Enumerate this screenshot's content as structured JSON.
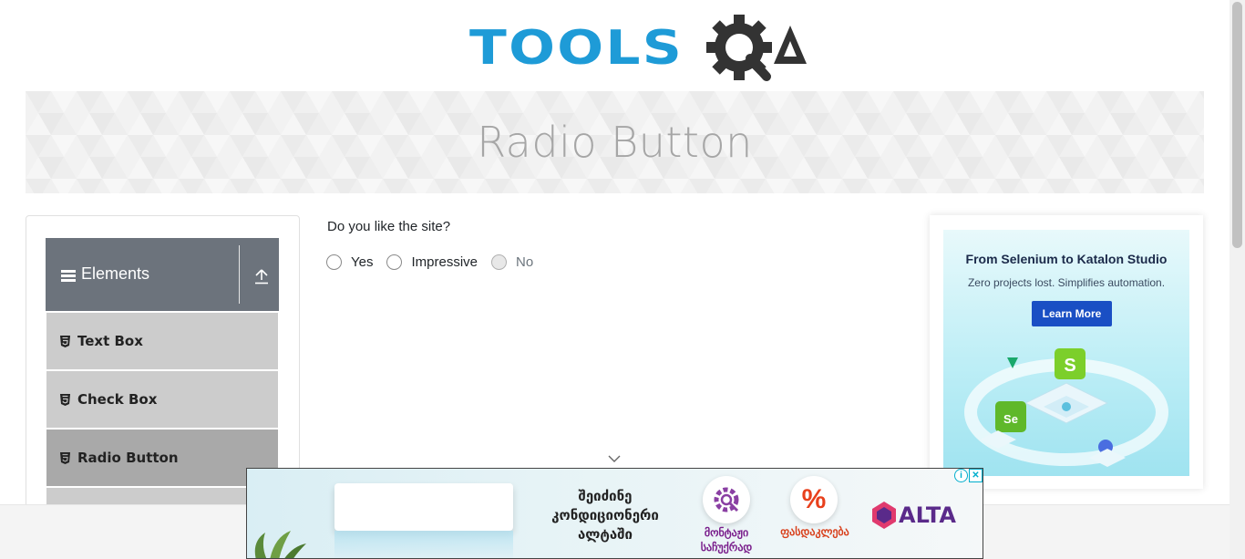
{
  "logo": {
    "text": "TOOLS",
    "mark": "QA"
  },
  "banner": {
    "title": "Radio Button"
  },
  "sidebar": {
    "group_label": "Elements",
    "items": [
      {
        "label": "Text Box",
        "active": false
      },
      {
        "label": "Check Box",
        "active": false
      },
      {
        "label": "Radio Button",
        "active": true
      }
    ]
  },
  "main": {
    "question": "Do you like the site?",
    "options": [
      {
        "label": "Yes",
        "checked": false,
        "disabled": false
      },
      {
        "label": "Impressive",
        "checked": false,
        "disabled": false
      },
      {
        "label": "No",
        "checked": false,
        "disabled": true
      }
    ]
  },
  "side_ad": {
    "headline": "From Selenium to Katalon Studio",
    "subline": "Zero projects lost. Simplifies automation.",
    "cta": "Learn More"
  },
  "bottom_ad": {
    "headline_lines": [
      "შეიძინე",
      "კონდიციონერი",
      "ალტაში"
    ],
    "caption_install_1": "მონტაჟი",
    "caption_install_2": "საჩუქრად",
    "caption_discount": "ფასდაკლება",
    "discount_symbol": "%",
    "brand": "ALTA",
    "adchoices_info": "i",
    "adchoices_close": "✕"
  },
  "colors": {
    "brand_blue": "#1e9bd7",
    "sidebar_header": "#6c737c",
    "menu_item": "#cccccc",
    "menu_item_active": "#a9a9a9"
  }
}
